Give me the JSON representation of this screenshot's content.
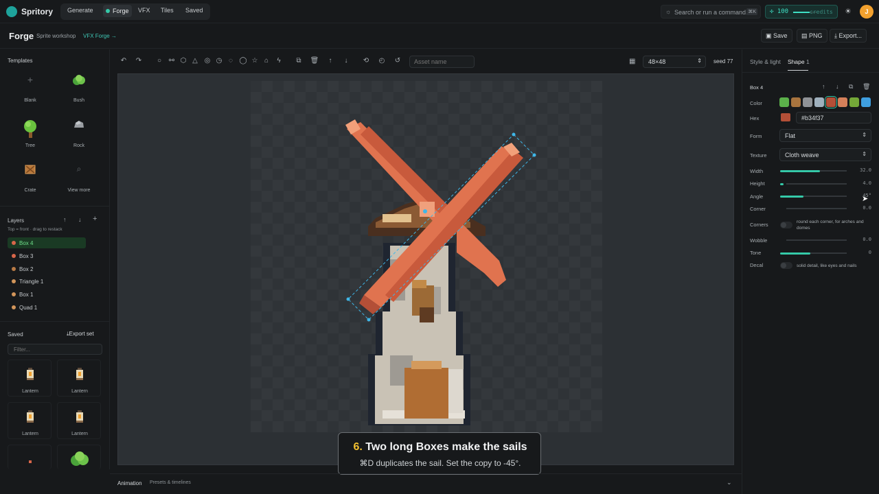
{
  "app": {
    "name": "Spritory"
  },
  "nav": {
    "tabs": [
      {
        "label": "Generate"
      },
      {
        "label": "Forge"
      },
      {
        "label": "VFX"
      },
      {
        "label": "Tiles"
      },
      {
        "label": "Saved"
      }
    ],
    "active": "Forge"
  },
  "search": {
    "placeholder": "Search or run a command...",
    "shortcut": "⌘K"
  },
  "credits": {
    "value": "100",
    "label": "credits",
    "level": 0.7
  },
  "avatar": {
    "initial": "J"
  },
  "page": {
    "title": "Forge",
    "subtitle": "Sprite workshop",
    "link": "VFX Forge →"
  },
  "header_actions": {
    "save": "Save",
    "png": "PNG",
    "export": "Export..."
  },
  "templates": {
    "title": "Templates",
    "items": [
      {
        "label": "Blank",
        "icon": "plus-icon"
      },
      {
        "label": "Bush",
        "icon": "bush-sprite"
      },
      {
        "label": "Tree",
        "icon": "tree-sprite"
      },
      {
        "label": "Rock",
        "icon": "rock-sprite"
      },
      {
        "label": "Crate",
        "icon": "crate-sprite"
      },
      {
        "label": "View more",
        "icon": "search-icon"
      }
    ]
  },
  "layers": {
    "title": "Layers",
    "hint": "Top = front · drag to restack",
    "items": [
      {
        "name": "Box 4",
        "color": "#d8664a",
        "selected": true
      },
      {
        "name": "Box 3",
        "color": "#d8664a"
      },
      {
        "name": "Box 2",
        "color": "#b87a45"
      },
      {
        "name": "Triangle 1",
        "color": "#d2955a"
      },
      {
        "name": "Box 1",
        "color": "#d2955a"
      },
      {
        "name": "Quad 1",
        "color": "#d2955a"
      }
    ]
  },
  "saved": {
    "title": "Saved",
    "export": "Export set",
    "filter_placeholder": "Filter...",
    "items": [
      {
        "label": "Lantern"
      },
      {
        "label": "Lantern"
      },
      {
        "label": "Lantern"
      },
      {
        "label": "Lantern"
      },
      {
        "label": ""
      },
      {
        "label": ""
      }
    ]
  },
  "toolbar": {
    "asset_name_placeholder": "Asset name",
    "size": "48×48",
    "seed": "seed 77"
  },
  "tooltip": {
    "step": "6.",
    "title": "Two long Boxes make the sails",
    "body": "⌘D duplicates the sail. Set the copy to -45°."
  },
  "animation": {
    "label": "Animation",
    "sub": "Presets & timelines"
  },
  "inspector": {
    "tabs": [
      {
        "label": "Style & light"
      },
      {
        "label": "Shape",
        "badge": "1"
      }
    ],
    "shape_name": "Box 4",
    "color_label": "Color",
    "swatches": [
      "#5bb04a",
      "#a8743e",
      "#8f9296",
      "#9fb0bd",
      "#b34f37",
      "#d5805a",
      "#74a838",
      "#3f9fe0"
    ],
    "selected_swatch": 4,
    "hex_label": "Hex",
    "hex": "#b34f37",
    "form_label": "Form",
    "form": "Flat",
    "texture_label": "Texture",
    "texture": "Cloth weave",
    "width": {
      "label": "Width",
      "value": "32.0",
      "level": 0.6
    },
    "height": {
      "label": "Height",
      "value": "4.0",
      "level": 0.05
    },
    "angle": {
      "label": "Angle",
      "value": "45°",
      "level": 0.35
    },
    "corner": {
      "label": "Corner",
      "value": "0.0",
      "level": 0
    },
    "corners": {
      "label": "Corners",
      "hint": "round each corner, for arches and domes"
    },
    "wobble": {
      "label": "Wobble",
      "value": "0.0",
      "level": 0
    },
    "tone": {
      "label": "Tone",
      "value": "0",
      "level": 0.45
    },
    "decal": {
      "label": "Decal",
      "hint": "solid detail, like eyes and nails"
    }
  }
}
